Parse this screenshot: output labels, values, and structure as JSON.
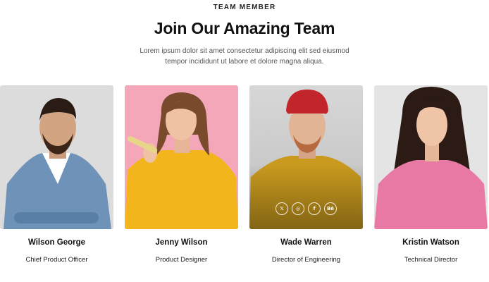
{
  "section": {
    "eyebrow": "TEAM MEMBER",
    "title": "Join Our Amazing Team",
    "description_line1": "Lorem ipsum dolor sit amet consectetur adipiscing elit sed eiusmod",
    "description_line2": "tempor incididunt ut labore et dolore magna aliqua."
  },
  "members": [
    {
      "name": "Wilson George",
      "role": "Chief Product Officer",
      "photo_bg": "#dcdcdc"
    },
    {
      "name": "Jenny Wilson",
      "role": "Product Designer",
      "photo_bg": "#f4a7b9"
    },
    {
      "name": "Wade Warren",
      "role": "Director of Engineering",
      "photo_bg": "#cfcfcf"
    },
    {
      "name": "Kristin Watson",
      "role": "Technical Director",
      "photo_bg": "#e4e4e4"
    }
  ],
  "socials": [
    {
      "icon": "x-icon",
      "glyph": "𝕏"
    },
    {
      "icon": "instagram-icon",
      "glyph": "◎"
    },
    {
      "icon": "facebook-icon",
      "glyph": "f"
    },
    {
      "icon": "behance-icon",
      "glyph": "Bē"
    }
  ]
}
